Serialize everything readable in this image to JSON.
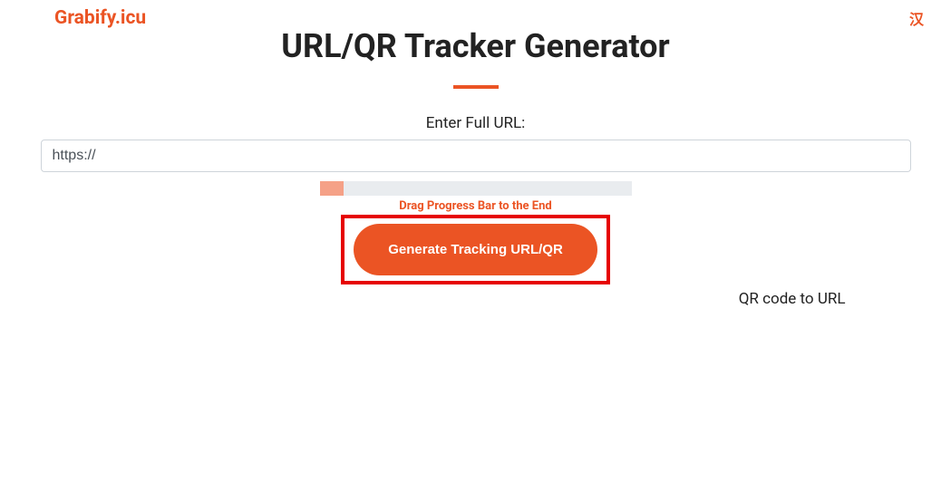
{
  "header": {
    "logo": "Grabify.icu",
    "lang": "汉"
  },
  "main": {
    "title": "URL/QR Tracker Generator",
    "url_label": "Enter Full URL:",
    "url_value": "https://",
    "drag_hint": "Drag Progress Bar to the End",
    "generate_button": "Generate Tracking URL/QR",
    "qr_link": "QR code to URL"
  }
}
